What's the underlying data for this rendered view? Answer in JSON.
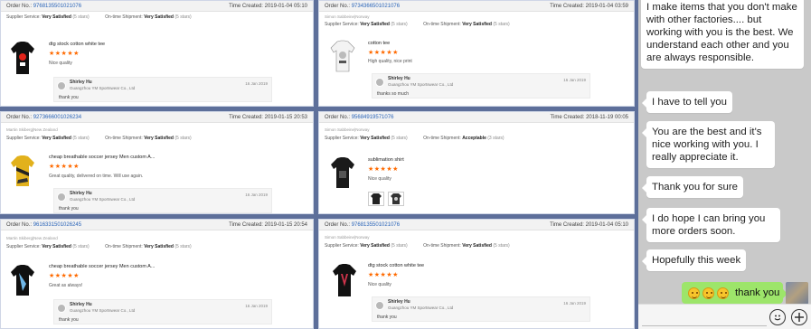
{
  "orders": [
    {
      "order_label": "Order No.:",
      "order_no": "97681355010210​76",
      "time_label": "Time Created:",
      "time": "2019-01-04 05:10",
      "buyer": "",
      "supplier_service_label": "Supplier Service:",
      "supplier_service": "Very Satisfied",
      "supplier_stars": "(5 stars)",
      "shipment_label": "On-time Shipment:",
      "shipment": "Very Satisfied",
      "shipment_stars": "(5 stars)",
      "product": "dtg stock cotton white tee",
      "stars": "★★★★★",
      "comment": "Nice quality",
      "reply_name": "Shirley Hu",
      "reply_company": "Guangzhou YM Sportswear Co., Ltd",
      "reply_date": "16 Jan 2019",
      "reply_msg": "thank you"
    },
    {
      "order_label": "Order No.:",
      "order_no": "97343665010210​76",
      "time_label": "Time Created:",
      "time": "2019-01-04 03:59",
      "buyer": "Simon Sabbeine|Norway",
      "supplier_service_label": "Supplier Service:",
      "supplier_service": "Very Satisfied",
      "supplier_stars": "(5 stars)",
      "shipment_label": "On-time Shipment:",
      "shipment": "Very Satisfied",
      "shipment_stars": "(5 stars)",
      "product": "cotton tee",
      "stars": "★★★★★",
      "comment": "High quality, nice print",
      "reply_name": "Shirley Hu",
      "reply_company": "Guangzhou YM Sportswear Co., Ltd",
      "reply_date": "16 Jan 2019",
      "reply_msg": "thanks so much"
    },
    {
      "order_label": "Order No.:",
      "order_no": "92736660010262​34",
      "time_label": "Time Created:",
      "time": "2019-01-15 20:53",
      "buyer": "Martin Skiberg|New Zealand",
      "supplier_service_label": "Supplier Service:",
      "supplier_service": "Very Satisfied",
      "supplier_stars": "(5 stars)",
      "shipment_label": "On-time Shipment:",
      "shipment": "Very Satisfied",
      "shipment_stars": "(5 stars)",
      "product": "cheap breathable soccer jersey Men custom A...",
      "stars": "★★★★★",
      "comment": "Great quality, delivered on time. Will use again.",
      "reply_name": "Shirley Hu",
      "reply_company": "Guangzhou YM Sportswear Co., Ltd",
      "reply_date": "16 Jan 2019",
      "reply_msg": "thank you"
    },
    {
      "order_label": "Order No.:",
      "order_no": "95684919571076",
      "time_label": "Time Created:",
      "time": "2018-11-19 00:05",
      "buyer": "Simon Sabbeine|Norway",
      "supplier_service_label": "Supplier Service:",
      "supplier_service": "Very Satisfied",
      "supplier_stars": "(5 stars)",
      "shipment_label": "On-time Shipment:",
      "shipment": "Acceptable",
      "shipment_stars": "(3 stars)",
      "product": "sublimation shirt",
      "stars": "★★★★★",
      "comment": "Nice quality",
      "reply_name": "",
      "reply_company": "",
      "reply_date": "",
      "reply_msg": ""
    },
    {
      "order_label": "Order No.:",
      "order_no": "96163315010262​45",
      "time_label": "Time Created:",
      "time": "2019-01-15 20:54",
      "buyer": "Martin Skiberg|New Zealand",
      "supplier_service_label": "Supplier Service:",
      "supplier_service": "Very Satisfied",
      "supplier_stars": "(5 stars)",
      "shipment_label": "On-time Shipment:",
      "shipment": "Very Satisfied",
      "shipment_stars": "(5 stars)",
      "product": "cheap breathable soccer jersey Men custom A...",
      "stars": "★★★★★",
      "comment": "Great as always!",
      "reply_name": "Shirley Hu",
      "reply_company": "Guangzhou YM Sportswear Co., Ltd",
      "reply_date": "16 Jan 2019",
      "reply_msg": "thank you"
    },
    {
      "order_label": "Order No.:",
      "order_no": "97681355010210​76",
      "time_label": "Time Created:",
      "time": "2019-01-04 05:10",
      "buyer": "Simon Sabbeine|Norway",
      "supplier_service_label": "Supplier Service:",
      "supplier_service": "Very Satisfied",
      "supplier_stars": "(5 stars)",
      "shipment_label": "On-time Shipment:",
      "shipment": "Very Satisfied",
      "shipment_stars": "(5 stars)",
      "product": "dtg stock cotton white tee",
      "stars": "★★★★★",
      "comment": "Nice quality",
      "reply_name": "Shirley Hu",
      "reply_company": "Guangzhou YM Sportswear Co., Ltd",
      "reply_date": "16 Jan 2019",
      "reply_msg": "thank you"
    }
  ],
  "chat": {
    "messages": [
      "I make items that you don't make with other factories.... but working with you is the best. We understand each other and you are always responsible.",
      "I have to tell you",
      "You are the best and it's nice working with you. I really appreciate it.",
      "Thank you for sure",
      "I do hope I can bring you more orders soon.",
      "Hopefully this week"
    ],
    "sent_text": "thank you",
    "emoji_icon": "smiley-emoji-icon",
    "bubble_color": "#ffffff",
    "sent_color": "#9de56a",
    "background_color": "#c9c9c9"
  },
  "colors": {
    "order_no_color": "#2a64b8",
    "stars_color": "#ff6a00",
    "collage_border": "#5d6f9a"
  }
}
